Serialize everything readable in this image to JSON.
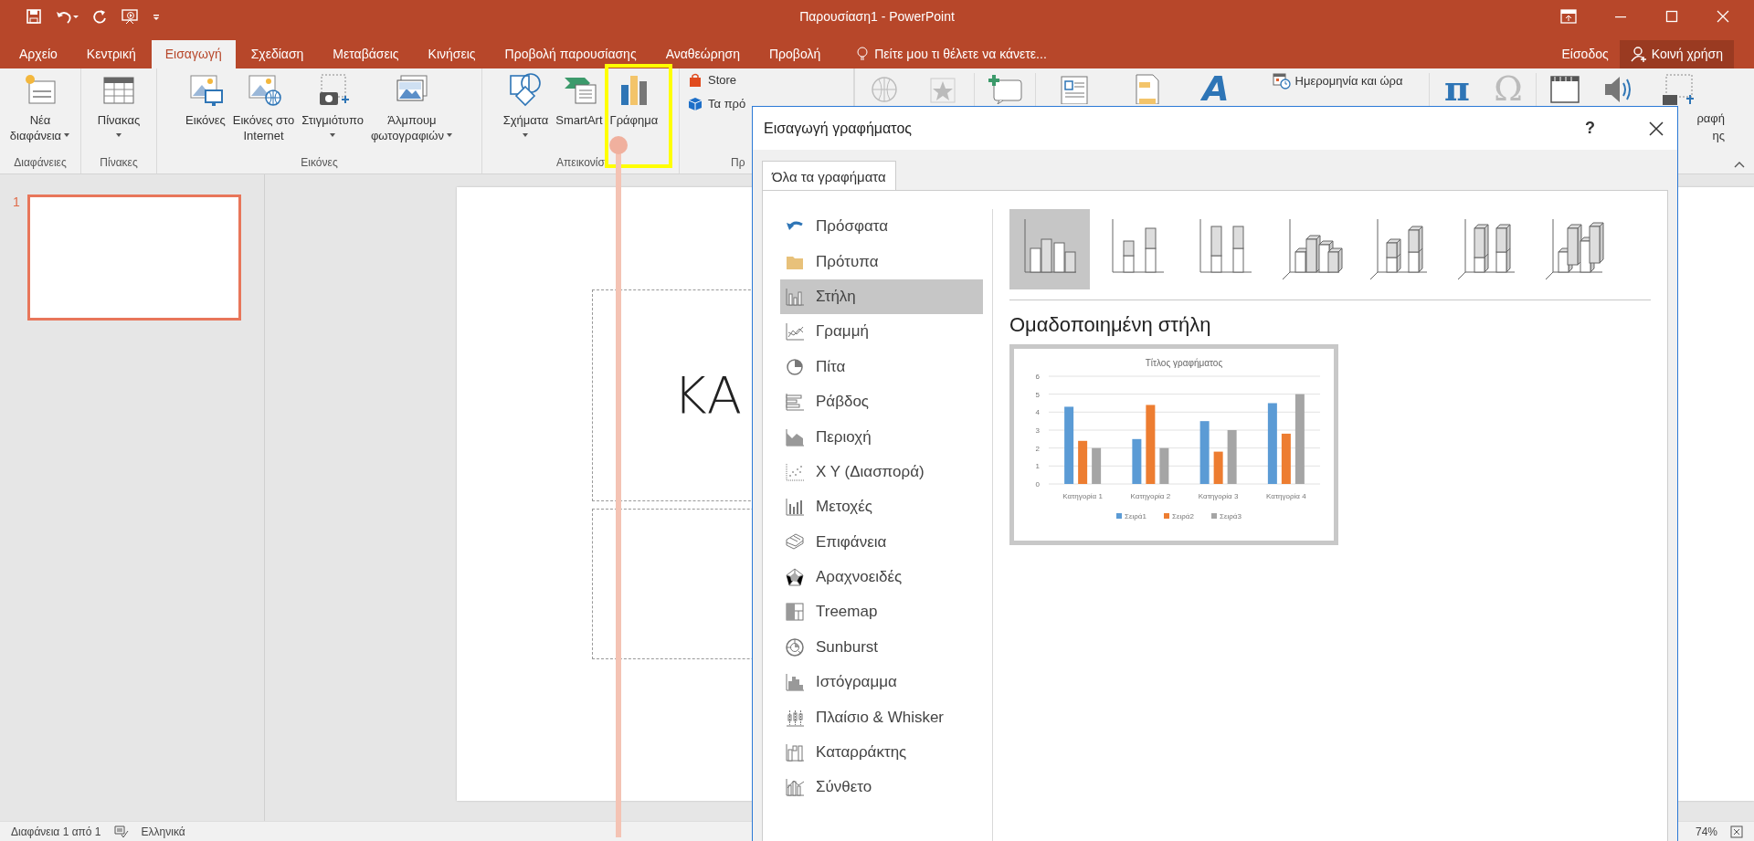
{
  "window": {
    "title": "Παρουσίαση1 - PowerPoint"
  },
  "tabs": [
    {
      "label": "Αρχείο",
      "selected": false
    },
    {
      "label": "Κεντρική",
      "selected": false
    },
    {
      "label": "Εισαγωγή",
      "selected": true
    },
    {
      "label": "Σχεδίαση",
      "selected": false
    },
    {
      "label": "Μεταβάσεις",
      "selected": false
    },
    {
      "label": "Κινήσεις",
      "selected": false
    },
    {
      "label": "Προβολή παρουσίασης",
      "selected": false
    },
    {
      "label": "Αναθεώρηση",
      "selected": false
    },
    {
      "label": "Προβολή",
      "selected": false
    }
  ],
  "tell_me": "Πείτε μου τι θέλετε να κάνετε...",
  "sign_in": "Είσοδος",
  "share": "Κοινή χρήση",
  "ribbon": {
    "groups": [
      {
        "label": "Διαφάνειες",
        "buttons": [
          {
            "lines": [
              "Νέα",
              "διαφάνεια"
            ],
            "dropdown": true,
            "caret_below": false
          }
        ]
      },
      {
        "label": "Πίνακες",
        "buttons": [
          {
            "lines": [
              "Πίνακας"
            ],
            "dropdown": true,
            "caret_below": true
          }
        ]
      },
      {
        "label": "Εικόνες",
        "buttons": [
          {
            "lines": [
              "Εικόνες"
            ],
            "dropdown": false
          },
          {
            "lines": [
              "Εικόνες στο",
              "Internet"
            ],
            "dropdown": false
          },
          {
            "lines": [
              "Στιγμιότυπο"
            ],
            "dropdown": true,
            "caret_below": true
          },
          {
            "lines": [
              "Άλμπουμ",
              "φωτογραφιών"
            ],
            "dropdown": true,
            "caret_below": false
          }
        ]
      },
      {
        "label": "Απεικονίσ",
        "buttons": [
          {
            "lines": [
              "Σχήματα"
            ],
            "dropdown": true,
            "caret_below": true
          },
          {
            "lines": [
              "SmartArt"
            ],
            "dropdown": false
          },
          {
            "lines": [
              "Γράφημα"
            ],
            "dropdown": false
          }
        ]
      },
      {
        "label": "Πρ",
        "small_buttons": [
          "Store",
          "Τα πρό"
        ]
      }
    ],
    "wordart_glyph": "A",
    "date_time": "Ημερομηνία και ώρα",
    "equation_glyph": "π",
    "symbol_glyph": "Ω",
    "screen_recording_lines": [
      "ραφή",
      "ης"
    ]
  },
  "slides": [
    {
      "number": "1",
      "selected": true
    }
  ],
  "slide": {
    "title": "ΚΑ"
  },
  "status_bar": {
    "slide": "Διαφάνεια 1 από 1",
    "language": "Ελληνικά",
    "zoom": "74%"
  },
  "dialog": {
    "title": "Εισαγωγή γραφήματος",
    "help": "?",
    "tabs": [
      {
        "label": "Όλα τα γραφήματα",
        "selected": true
      }
    ],
    "chart_types": [
      {
        "label": "Πρόσφατα",
        "selected": false
      },
      {
        "label": "Πρότυπα",
        "selected": false
      },
      {
        "label": "Στήλη",
        "selected": true
      },
      {
        "label": "Γραμμή",
        "selected": false
      },
      {
        "label": "Πίτα",
        "selected": false
      },
      {
        "label": "Ράβδος",
        "selected": false
      },
      {
        "label": "Περιοχή",
        "selected": false
      },
      {
        "label": "X Y (Διασπορά)",
        "selected": false
      },
      {
        "label": "Μετοχές",
        "selected": false
      },
      {
        "label": "Επιφάνεια",
        "selected": false
      },
      {
        "label": "Αραχνοειδές",
        "selected": false
      },
      {
        "label": "Treemap",
        "selected": false
      },
      {
        "label": "Sunburst",
        "selected": false
      },
      {
        "label": "Ιστόγραμμα",
        "selected": false
      },
      {
        "label": "Πλαίσιο & Whisker",
        "selected": false
      },
      {
        "label": "Καταρράκτης",
        "selected": false
      },
      {
        "label": "Σύνθετο",
        "selected": false
      }
    ],
    "subtypes": [
      {
        "selected": true
      },
      {
        "selected": false
      },
      {
        "selected": false
      },
      {
        "selected": false
      },
      {
        "selected": false
      },
      {
        "selected": false
      },
      {
        "selected": false
      }
    ],
    "subtype_title": "Ομαδοποιημένη στήλη",
    "preview": {
      "chart_data": {
        "type": "bar",
        "title": "Τίτλος γραφήματος",
        "categories": [
          "Κατηγορία 1",
          "Κατηγορία 2",
          "Κατηγορία 3",
          "Κατηγορία 4"
        ],
        "series": [
          {
            "name": "Σειρά1",
            "color": "#5b9bd5",
            "values": [
              4.3,
              2.5,
              3.5,
              4.5
            ]
          },
          {
            "name": "Σειρά2",
            "color": "#ed7d31",
            "values": [
              2.4,
              4.4,
              1.8,
              2.8
            ]
          },
          {
            "name": "Σειρά3",
            "color": "#a5a5a5",
            "values": [
              2,
              2,
              3,
              5
            ]
          }
        ],
        "ylim": [
          0,
          6
        ],
        "yticks": [
          0,
          1,
          2,
          3,
          4,
          5,
          6
        ],
        "grid": true,
        "legend": "bottom"
      }
    }
  }
}
